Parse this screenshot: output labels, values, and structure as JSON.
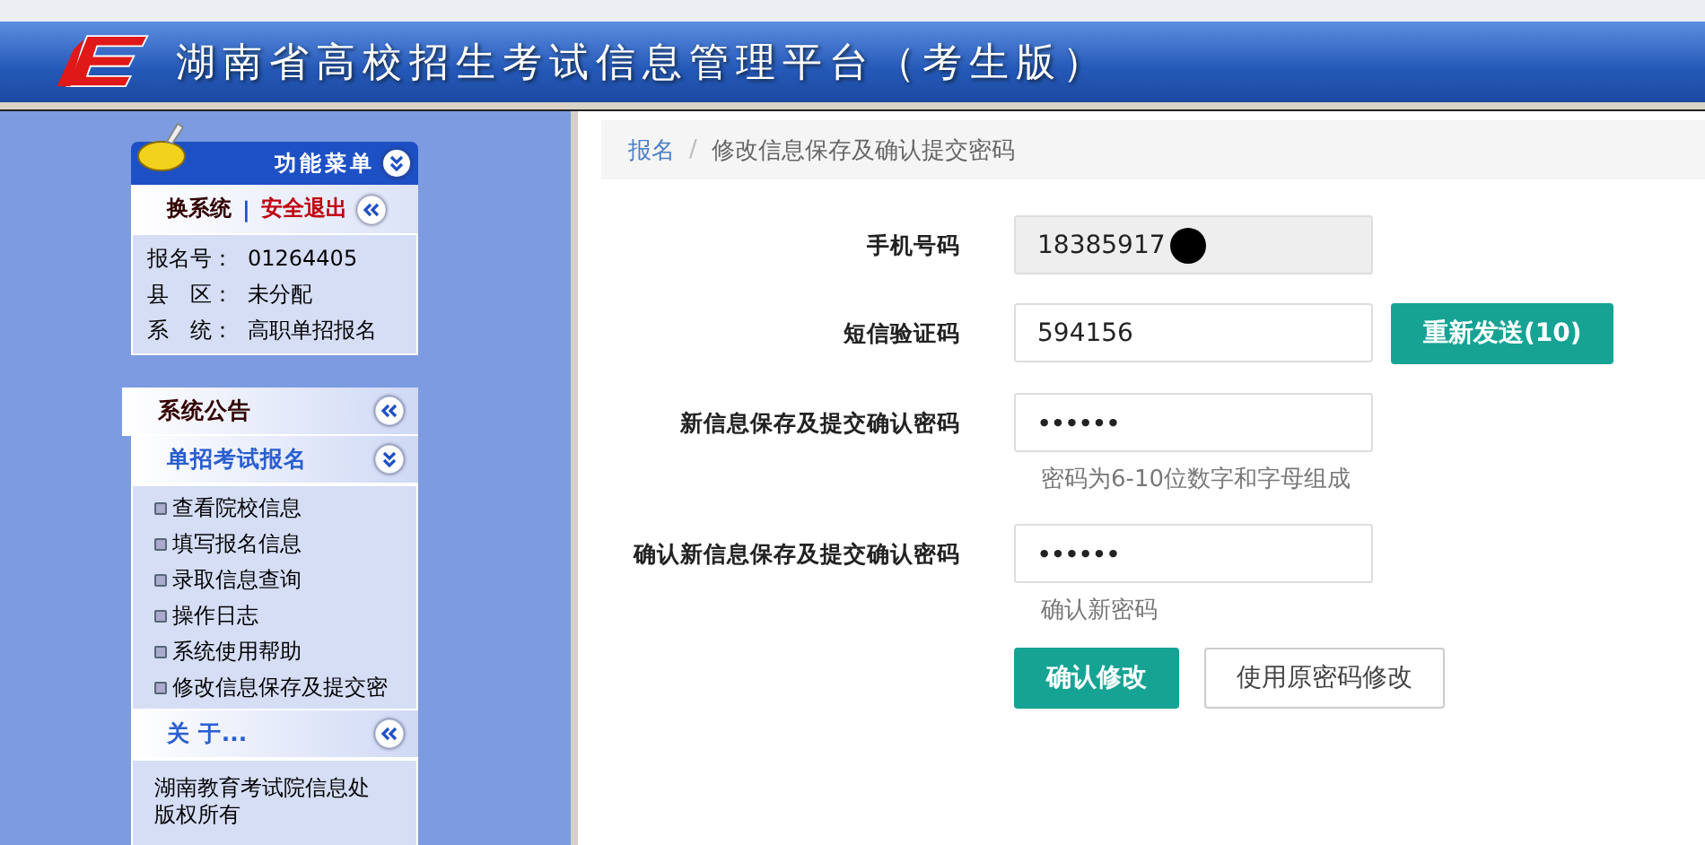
{
  "header": {
    "title": "湖南省高校招生考试信息管理平台（考生版）"
  },
  "sidebar": {
    "menu_title": "功能菜单",
    "switch_link": "换系统",
    "divider": "|",
    "logout_link": "安全退出",
    "info": [
      {
        "label": "报名号：",
        "value": "01264405"
      },
      {
        "label": "县　区：",
        "value": "未分配"
      },
      {
        "label": "系　统：",
        "value": "高职单招报名"
      }
    ],
    "sections": [
      {
        "title": "系统公告",
        "expanded": false
      },
      {
        "title": "单招考试报名",
        "expanded": true,
        "items": [
          "查看院校信息",
          "填写报名信息",
          "录取信息查询",
          "操作日志",
          "系统使用帮助",
          "修改信息保存及提交密"
        ]
      },
      {
        "title": "关 于...",
        "expanded": false,
        "text": "湖南教育考试院信息处版权所有"
      }
    ]
  },
  "breadcrumb": {
    "items": [
      "报名",
      "修改信息保存及确认提交密码"
    ],
    "separator": "/"
  },
  "form": {
    "rows": [
      {
        "label": "手机号码",
        "kind": "readonly",
        "value": "18385917",
        "redacted": true
      },
      {
        "label": "短信验证码",
        "kind": "text",
        "value": "594156",
        "button": "重新发送(10)"
      },
      {
        "label": "新信息保存及提交确认密码",
        "kind": "password",
        "value": "••••••",
        "help": "密码为6-10位数字和字母组成"
      },
      {
        "label": "确认新信息保存及提交确认密码",
        "kind": "password",
        "value": "••••••",
        "help": "确认新密码"
      }
    ],
    "buttons": [
      {
        "label": "确认修改",
        "kind": "primary"
      },
      {
        "label": "使用原密码修改",
        "kind": "default"
      }
    ]
  }
}
